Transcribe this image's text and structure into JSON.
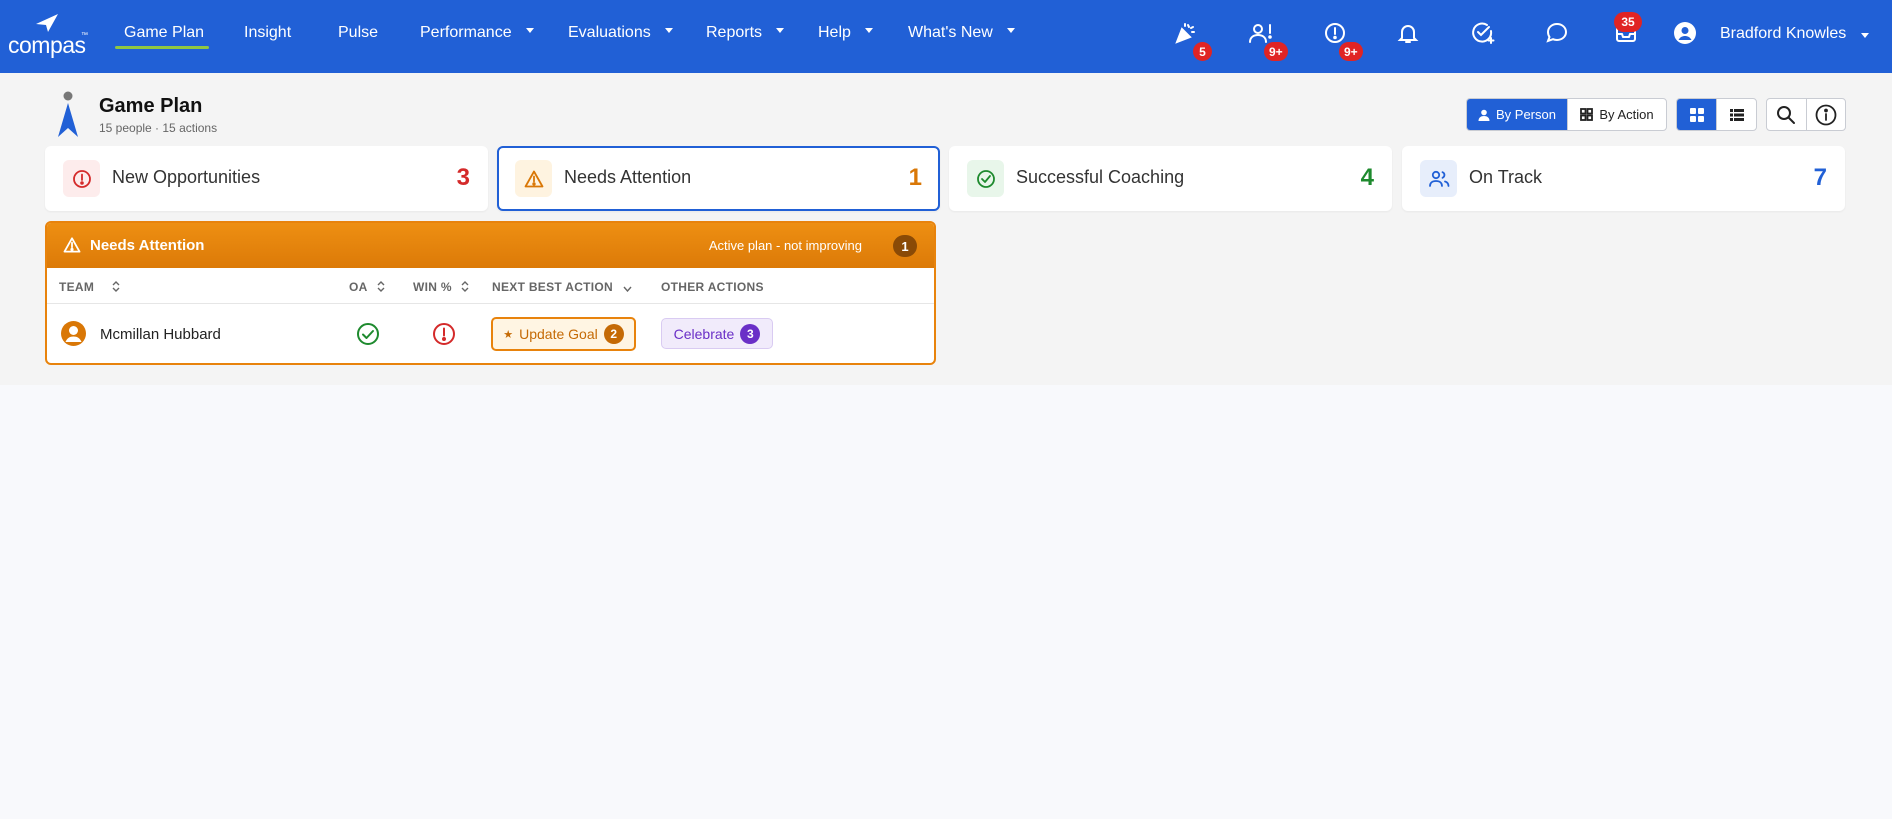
{
  "brand": {
    "name": "compas",
    "tm": "™"
  },
  "nav": {
    "items": [
      {
        "label": "Game Plan",
        "active": true
      },
      {
        "label": "Insight"
      },
      {
        "label": "Pulse"
      },
      {
        "label": "Performance",
        "dropdown": true
      },
      {
        "label": "Evaluations",
        "dropdown": true
      },
      {
        "label": "Reports",
        "dropdown": true
      },
      {
        "label": "Help",
        "dropdown": true
      },
      {
        "label": "What's New",
        "dropdown": true
      }
    ],
    "icons": [
      {
        "name": "celebrate-icon",
        "badge": "5"
      },
      {
        "name": "user-alert-icon",
        "badge": "9+"
      },
      {
        "name": "alert-circle-icon",
        "badge": "9+"
      },
      {
        "name": "bell-icon",
        "badge": ""
      },
      {
        "name": "check-badge-icon",
        "badge": ""
      },
      {
        "name": "chat-icon",
        "badge": ""
      },
      {
        "name": "inbox-icon",
        "badge": "35"
      }
    ],
    "user": {
      "name": "Bradford Knowles"
    }
  },
  "page": {
    "title": "Game Plan",
    "subtitle": "15 people · 15 actions",
    "view_toggle": {
      "by_person": "By Person",
      "by_action": "By Action",
      "selected": "by_person"
    },
    "layout_toggle": {
      "selected": "grid"
    }
  },
  "cards": [
    {
      "label": "New Opportunities",
      "count": "3",
      "color": "#d42a2a",
      "bg": "#fdecec"
    },
    {
      "label": "Needs Attention",
      "count": "1",
      "color": "#d97706",
      "bg": "#fef3e0"
    },
    {
      "label": "Successful Coaching",
      "count": "4",
      "color": "#1e8a2e",
      "bg": "#e8f6ea"
    },
    {
      "label": "On Track",
      "count": "7",
      "color": "#2160d6",
      "bg": "#e7eefb"
    }
  ],
  "panel": {
    "title": "Needs Attention",
    "subtitle": "Active plan - not improving",
    "subtitle_count": "1",
    "columns": {
      "team": "TEAM",
      "oa": "OA",
      "win": "WIN %",
      "nba": "NEXT BEST ACTION",
      "other": "OTHER ACTIONS"
    },
    "rows": [
      {
        "name": "Mcmillan Hubbard",
        "oa": "ok",
        "win": "alert",
        "next_best_action": {
          "label": "Update Goal",
          "count": "2"
        },
        "other_action": {
          "label": "Celebrate",
          "count": "3"
        }
      }
    ]
  },
  "colors": {
    "brand": "#2160d6",
    "accent_green": "#8fc743",
    "warning": "#e8830c",
    "purple": "#6a2fc7",
    "badge_red": "#e02424"
  }
}
